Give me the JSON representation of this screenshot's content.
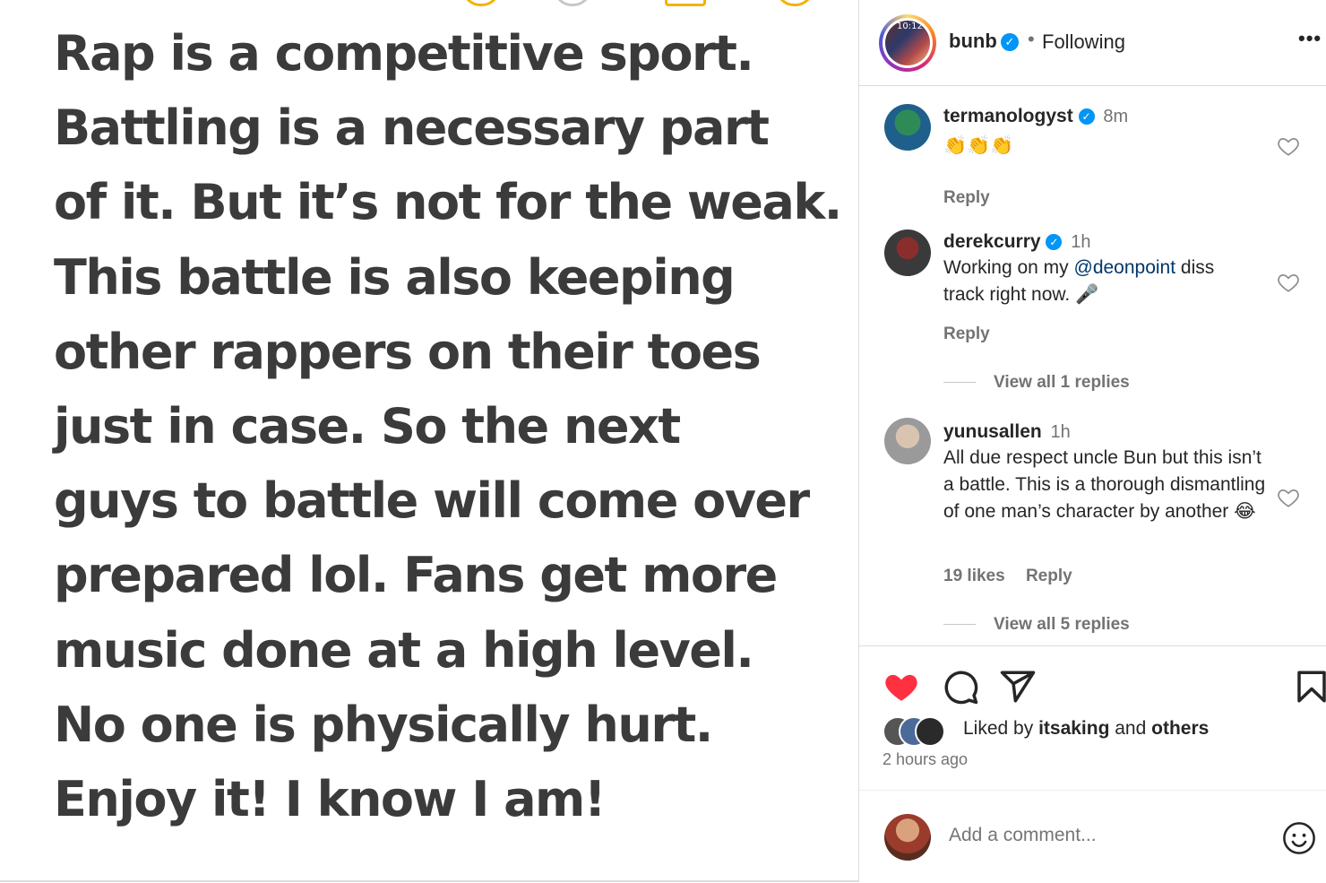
{
  "post": {
    "text": "Rap is a competitive sport.\nBattling is a necessary part\nof it. But it’s not for the weak.\nThis battle is also keeping\nother rappers on their toes\njust in case. So the next\nguys to battle will come over\nprepared lol. Fans get more\nmusic done at a high level.\nNo one is physically hurt.\nEnjoy it! I know I am!"
  },
  "header": {
    "avatar_time": "10:12",
    "username": "bunb",
    "verified_glyph": "✓",
    "separator": "•",
    "follow_status": "Following",
    "more": "•••"
  },
  "comments": [
    {
      "username": "termanologyst",
      "verified": true,
      "time": "8m",
      "text": "👏👏👏",
      "likes": "",
      "reply": "Reply",
      "avatar_colors": [
        "#2e8b57",
        "#1f5f8b"
      ]
    },
    {
      "username": "derekcurry",
      "verified": true,
      "time": "1h",
      "text_before": "Working on my ",
      "mention": "@deonpoint",
      "text_after": " diss track right now. 🎤",
      "reply": "Reply",
      "view_replies": "View all 1 replies",
      "avatar_colors": [
        "#3a3a3a",
        "#8a2d2d"
      ]
    },
    {
      "username": "yunusallen",
      "verified": false,
      "time": "1h",
      "text": "All due respect uncle Bun but this isn’t a battle. This is a thorough dismantling of one man’s character by another 😂",
      "likes": "19 likes",
      "reply": "Reply",
      "view_replies": "View all 5 replies",
      "avatar_colors": [
        "#9a9a9a",
        "#5d4a3a"
      ]
    }
  ],
  "actions": {
    "liked_prefix": "Liked by ",
    "liked_user": "itsaking",
    "liked_middle": " and ",
    "liked_others": "others",
    "time_ago": "2 hours ago",
    "comment_placeholder": "Add a comment...",
    "heart_color": "#ff3040"
  }
}
